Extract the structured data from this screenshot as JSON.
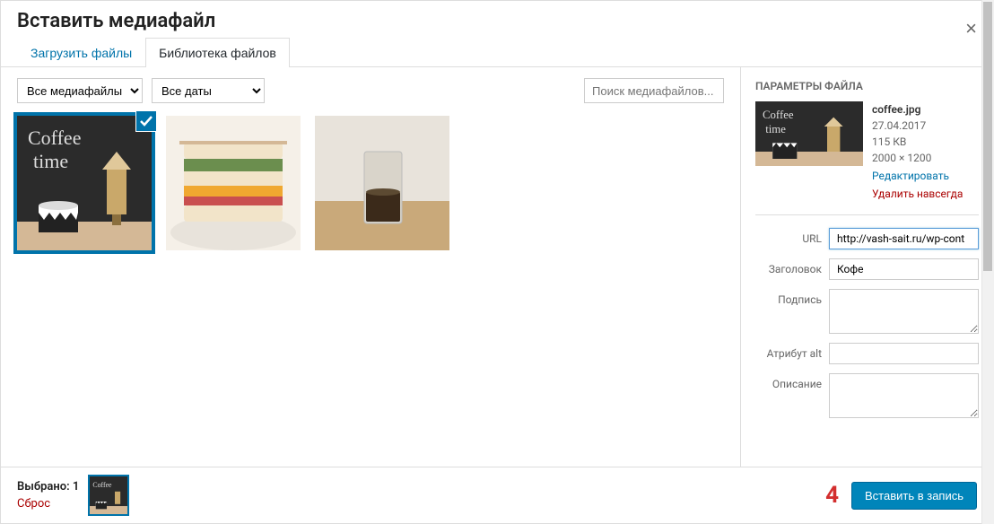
{
  "modal": {
    "title": "Вставить медиафайл",
    "close_icon": "×"
  },
  "tabs": {
    "upload": "Загрузить файлы",
    "library": "Библиотека файлов"
  },
  "filters": {
    "all_media": "Все медиафайлы",
    "all_dates": "Все даты",
    "search_placeholder": "Поиск медиафайлов..."
  },
  "thumbs": [
    {
      "alt": "coffee chalkboard",
      "selected": true
    },
    {
      "alt": "sandwich",
      "selected": false
    },
    {
      "alt": "glass coffee",
      "selected": false
    }
  ],
  "sidebar": {
    "section_title": "ПАРАМЕТРЫ ФАЙЛА",
    "file": {
      "name": "coffee.jpg",
      "date": "27.04.2017",
      "size": "115 КВ",
      "dims": "2000 × 1200",
      "edit": "Редактировать",
      "delete": "Удалить навсегда"
    },
    "fields": {
      "url_label": "URL",
      "url_value": "http://vash-sait.ru/wp-cont",
      "title_label": "Заголовок",
      "title_value": "Кофе",
      "caption_label": "Подпись",
      "caption_value": "",
      "alt_label": "Атрибут alt",
      "alt_value": "",
      "desc_label": "Описание",
      "desc_value": ""
    }
  },
  "footer": {
    "selected_label": "Выбрано: 1",
    "reset": "Сброс",
    "annotation": "4",
    "insert_button": "Вставить в запись"
  }
}
